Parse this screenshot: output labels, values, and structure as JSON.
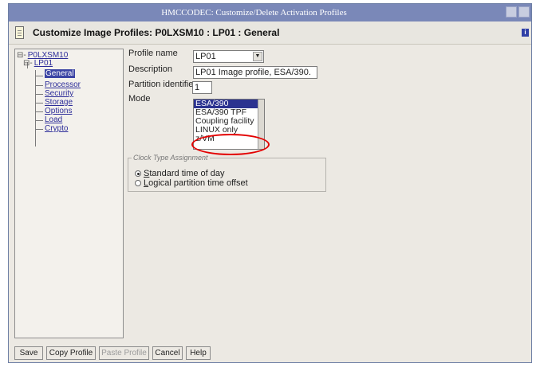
{
  "window": {
    "title": "HMCCODEC: Customize/Delete Activation Profiles"
  },
  "header": {
    "title": "Customize Image Profiles: P0LXSM10 : LP01 : General"
  },
  "tree": {
    "root": "P0LXSM10",
    "partition": "LP01",
    "items": [
      {
        "label": "General",
        "selected": true
      },
      {
        "label": "Processor",
        "selected": false
      },
      {
        "label": "Security",
        "selected": false
      },
      {
        "label": "Storage",
        "selected": false
      },
      {
        "label": "Options",
        "selected": false
      },
      {
        "label": "Load",
        "selected": false
      },
      {
        "label": "Crypto",
        "selected": false
      }
    ]
  },
  "form": {
    "profile_name_label": "Profile name",
    "profile_name_value": "LP01",
    "description_label": "Description",
    "description_value": "LP01 Image profile, ESA/390.",
    "partition_id_label": "Partition identifier",
    "partition_id_value": "1",
    "mode_label": "Mode",
    "mode_options": [
      "ESA/390",
      "ESA/390 TPF",
      "Coupling facility",
      "LINUX only",
      "z/VM"
    ],
    "mode_selected": "ESA/390",
    "clock_group_label": "Clock Type Assignment",
    "clock_options": [
      {
        "label": "Standard time of day",
        "selected": true
      },
      {
        "label": "Logical partition time offset",
        "selected": false
      }
    ]
  },
  "annotation": {
    "highlighted_option": "z/VM",
    "color": "#e30000"
  },
  "buttons": [
    {
      "label": "Save",
      "enabled": true
    },
    {
      "label": "Copy Profile",
      "enabled": true
    },
    {
      "label": "Paste Profile",
      "enabled": false
    },
    {
      "label": "Cancel",
      "enabled": true
    },
    {
      "label": "Help",
      "enabled": true
    }
  ],
  "colors": {
    "titlebar": "#7a88b8",
    "selection": "#2b3290",
    "link": "#2e2e9a"
  }
}
